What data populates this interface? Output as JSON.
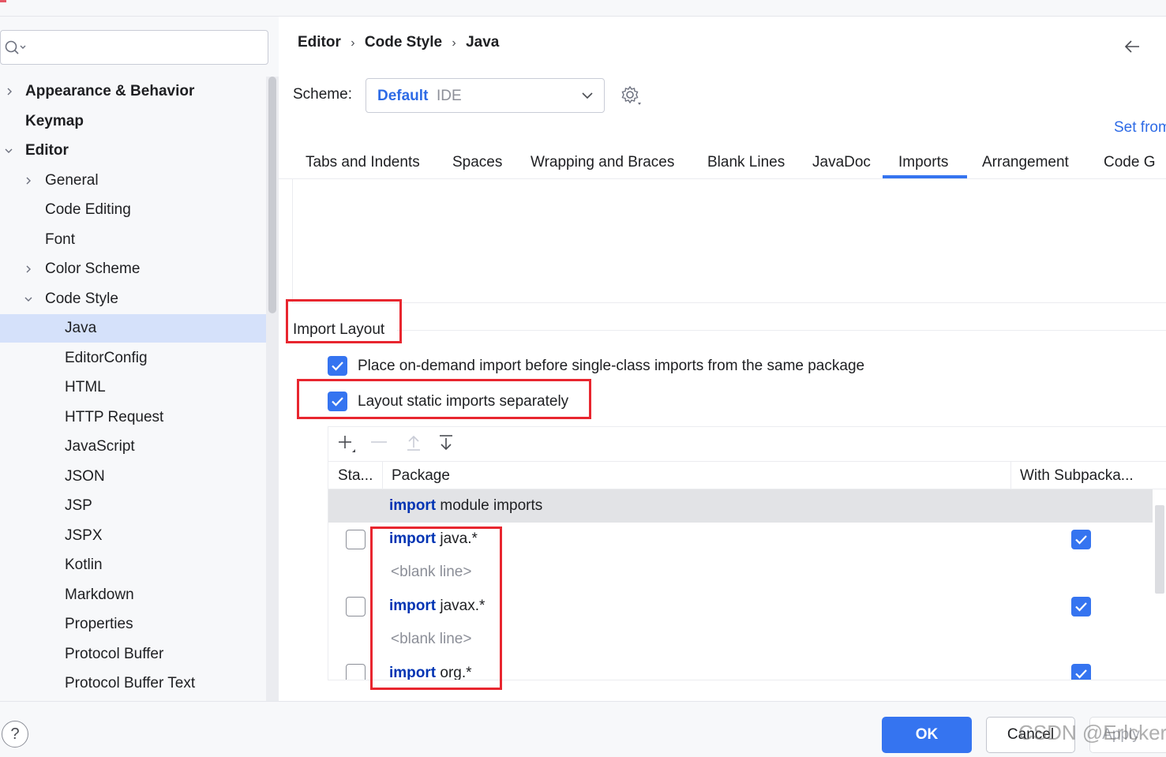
{
  "sidebar": {
    "search_placeholder": "",
    "items": [
      {
        "label": "Appearance & Behavior"
      },
      {
        "label": "Keymap"
      },
      {
        "label": "Editor"
      },
      {
        "label": "General"
      },
      {
        "label": "Code Editing"
      },
      {
        "label": "Font"
      },
      {
        "label": "Color Scheme"
      },
      {
        "label": "Code Style"
      },
      {
        "label": "Java"
      },
      {
        "label": "EditorConfig"
      },
      {
        "label": "HTML"
      },
      {
        "label": "HTTP Request"
      },
      {
        "label": "JavaScript"
      },
      {
        "label": "JSON"
      },
      {
        "label": "JSP"
      },
      {
        "label": "JSPX"
      },
      {
        "label": "Kotlin"
      },
      {
        "label": "Markdown"
      },
      {
        "label": "Properties"
      },
      {
        "label": "Protocol Buffer"
      },
      {
        "label": "Protocol Buffer Text"
      }
    ],
    "selected": "Java"
  },
  "breadcrumb": [
    "Editor",
    "Code Style",
    "Java"
  ],
  "breadcrumb_sep": "›",
  "scheme": {
    "label": "Scheme:",
    "value": "Default",
    "kind": "IDE"
  },
  "set_from_label": "Set from",
  "tabs": [
    {
      "label": "Tabs and Indents"
    },
    {
      "label": "Spaces"
    },
    {
      "label": "Wrapping and Braces"
    },
    {
      "label": "Blank Lines"
    },
    {
      "label": "JavaDoc"
    },
    {
      "label": "Imports"
    },
    {
      "label": "Arrangement"
    },
    {
      "label": "Code G"
    }
  ],
  "active_tab": "Imports",
  "import_layout": {
    "title": "Import Layout",
    "options": [
      {
        "label": "Place on-demand import before single-class imports from the same package",
        "checked": true
      },
      {
        "label": "Layout static imports separately",
        "checked": true
      }
    ],
    "columns": [
      "Sta...",
      "Package",
      "With Subpacka..."
    ],
    "rows": [
      {
        "keyword": "import",
        "text": "module imports",
        "type": "module",
        "static": null,
        "subpackages": null
      },
      {
        "keyword": "import",
        "text": "java.*",
        "type": "package",
        "static": false,
        "subpackages": true
      },
      {
        "keyword": "",
        "text": "<blank line>",
        "type": "blank"
      },
      {
        "keyword": "import",
        "text": "javax.*",
        "type": "package",
        "static": false,
        "subpackages": true
      },
      {
        "keyword": "",
        "text": "<blank line>",
        "type": "blank"
      },
      {
        "keyword": "import",
        "text": "org.*",
        "type": "package",
        "static": false,
        "subpackages": true
      }
    ]
  },
  "footer": {
    "help_label": "?",
    "ok_label": "OK",
    "cancel_label": "Cancel",
    "apply_label": "Apply",
    "watermark": "CSDN @Erlcker"
  },
  "colors": {
    "accent": "#3574f0",
    "keyword": "#0033b3",
    "highlight_box": "#e8262f",
    "selection": "#d5e1fa"
  }
}
